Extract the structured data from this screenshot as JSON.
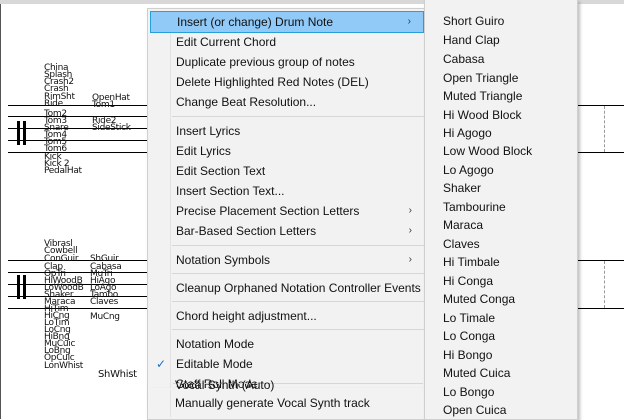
{
  "staff": {
    "upper_labels": [
      {
        "id": "china",
        "text": "China"
      },
      {
        "id": "splash",
        "text": "Splash"
      },
      {
        "id": "crash2",
        "text": "Crash2"
      },
      {
        "id": "crash",
        "text": "Crash"
      },
      {
        "id": "rimsht",
        "text": "RimSht"
      },
      {
        "id": "ride",
        "text": "Ride"
      },
      {
        "id": "tom2",
        "text": "Tom2"
      },
      {
        "id": "tom3",
        "text": "Tom3"
      },
      {
        "id": "snare",
        "text": "Snare"
      },
      {
        "id": "tom4",
        "text": "Tom4"
      },
      {
        "id": "tom5",
        "text": "Tom5"
      },
      {
        "id": "tom6",
        "text": "Tom6"
      },
      {
        "id": "kick",
        "text": "Kick"
      },
      {
        "id": "kick2",
        "text": "Kick 2"
      },
      {
        "id": "pedalhat",
        "text": "PedalHat"
      },
      {
        "id": "openhat",
        "text": "OpenHat"
      },
      {
        "id": "tom1",
        "text": "Tom1"
      },
      {
        "id": "ride2",
        "text": "Ride2"
      },
      {
        "id": "sidestick",
        "text": "SideStick"
      }
    ],
    "lower_labels": [
      {
        "id": "vibrasl",
        "text": "Vibrasl"
      },
      {
        "id": "cowbell",
        "text": "Cowbell"
      },
      {
        "id": "conguir",
        "text": "ConGuir"
      },
      {
        "id": "clap",
        "text": "Clap"
      },
      {
        "id": "optri",
        "text": "OpTri"
      },
      {
        "id": "hiwoodb",
        "text": "HiWoodB"
      },
      {
        "id": "lowoodb",
        "text": "LoWoodB"
      },
      {
        "id": "shaker",
        "text": "Shaker"
      },
      {
        "id": "maraca",
        "text": "Maraca"
      },
      {
        "id": "hitim",
        "text": "HiTim"
      },
      {
        "id": "hicng",
        "text": "HiCng"
      },
      {
        "id": "lotim",
        "text": "LoTim"
      },
      {
        "id": "locng",
        "text": "LoCng"
      },
      {
        "id": "hibng",
        "text": "HiBng"
      },
      {
        "id": "mucuic",
        "text": "MuCuic"
      },
      {
        "id": "lobng",
        "text": "LoBng"
      },
      {
        "id": "opcuic",
        "text": "OpCuic"
      },
      {
        "id": "lonwhist",
        "text": "LonWhist"
      },
      {
        "id": "shguir",
        "text": "ShGuir"
      },
      {
        "id": "cabasa",
        "text": "Cabasa"
      },
      {
        "id": "mutri",
        "text": "MuTri"
      },
      {
        "id": "hiago",
        "text": "HiAgo"
      },
      {
        "id": "loago",
        "text": "LoAgo"
      },
      {
        "id": "tambo",
        "text": "Tambo"
      },
      {
        "id": "claves",
        "text": "Claves"
      },
      {
        "id": "mucng",
        "text": "MuCng"
      },
      {
        "id": "shwhist",
        "text": "ShWhist"
      }
    ]
  },
  "main_menu": {
    "items": [
      {
        "label": "Insert (or change) Drum Note",
        "arrow": "›",
        "highlighted": true
      },
      {
        "label": "Edit Current Chord"
      },
      {
        "label": "Duplicate previous group of notes"
      },
      {
        "label": "Delete Highlighted Red Notes (DEL)"
      },
      {
        "label": "Change Beat Resolution..."
      },
      {
        "label": "Insert Lyrics"
      },
      {
        "label": "Edit Lyrics"
      },
      {
        "label": "Edit Section Text"
      },
      {
        "label": "Insert Section Text..."
      },
      {
        "label": "Precise Placement Section Letters",
        "arrow": "›"
      },
      {
        "label": "Bar-Based Section Letters",
        "arrow": "›"
      },
      {
        "label": "Notation Symbols",
        "arrow": "›"
      },
      {
        "label": "Cleanup Orphaned Notation Controller Events"
      },
      {
        "label": "Chord height adjustment..."
      },
      {
        "label": "Notation Mode"
      },
      {
        "label": "Editable Mode",
        "checked": true,
        "check": "✓"
      },
      {
        "label": "Staff Roll Mode"
      },
      {
        "label": "Vocal Synth (Auto)"
      },
      {
        "label": "Manually generate Vocal Synth track"
      }
    ]
  },
  "drum_submenu": {
    "items": [
      "Short Guiro",
      "Hand Clap",
      "Cabasa",
      "Open Triangle",
      "Muted Triangle",
      "Hi Wood Block",
      "Hi Agogo",
      "Low Wood Block",
      "Lo Agogo",
      "Shaker",
      "Tambourine",
      "Maraca",
      "Claves",
      "Hi Timbale",
      "Hi Conga",
      "Muted Conga",
      "Lo Timale",
      "Lo Conga",
      "Hi Bongo",
      "Muted Cuica",
      "Lo Bongo",
      "Open Cuica"
    ]
  }
}
